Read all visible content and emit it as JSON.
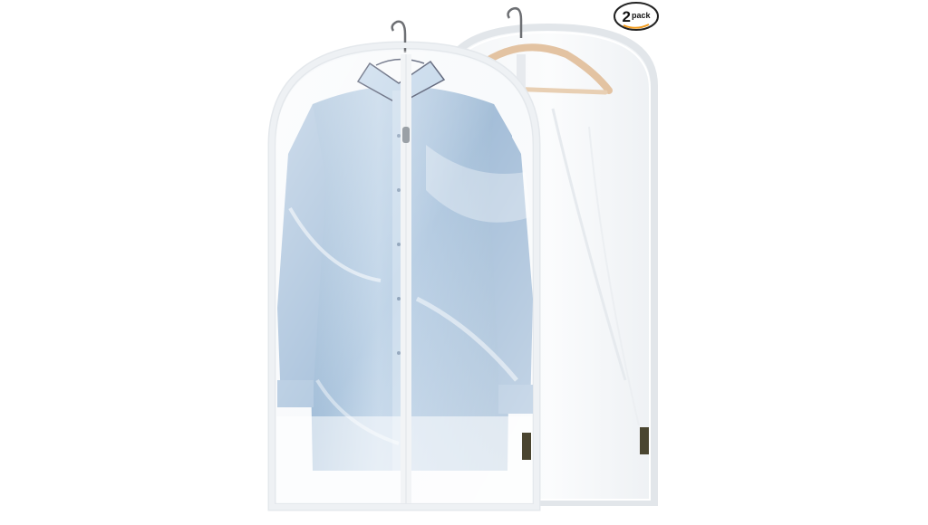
{
  "badge": {
    "number": "2",
    "word": "pack"
  },
  "brand_tag_text": "",
  "colors": {
    "background": "#ffffff",
    "shirt": "#a9c3dd",
    "bag_trim": "#f4f6f8",
    "hanger_wood": "#e3c3a2",
    "hook_metal": "#6d6f73",
    "badge_arrow": "#f29b1d"
  }
}
